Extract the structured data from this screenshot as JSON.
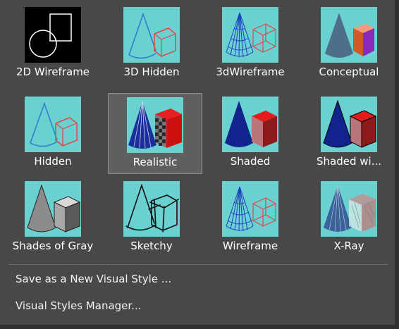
{
  "styles": [
    {
      "label": "2D Wireframe",
      "icon": "2d-wireframe-icon"
    },
    {
      "label": "3D Hidden",
      "icon": "3d-hidden-icon"
    },
    {
      "label": "3dWireframe",
      "icon": "3d-wireframe-icon"
    },
    {
      "label": "Conceptual",
      "icon": "conceptual-icon"
    },
    {
      "label": "Hidden",
      "icon": "hidden-icon"
    },
    {
      "label": "Realistic",
      "icon": "realistic-icon",
      "selected": true
    },
    {
      "label": "Shaded",
      "icon": "shaded-icon"
    },
    {
      "label": "Shaded wi...",
      "icon": "shaded-with-edges-icon"
    },
    {
      "label": "Shades of Gray",
      "icon": "shades-of-gray-icon"
    },
    {
      "label": "Sketchy",
      "icon": "sketchy-icon"
    },
    {
      "label": "Wireframe",
      "icon": "wireframe-icon"
    },
    {
      "label": "X-Ray",
      "icon": "x-ray-icon"
    }
  ],
  "commands": {
    "save_new": "Save as a New Visual Style ...",
    "manager": "Visual Styles Manager..."
  },
  "colors": {
    "thumb_bg": "#6ad0d0",
    "menu_bg": "#484848",
    "selected_bg": "#5f5f5f"
  }
}
